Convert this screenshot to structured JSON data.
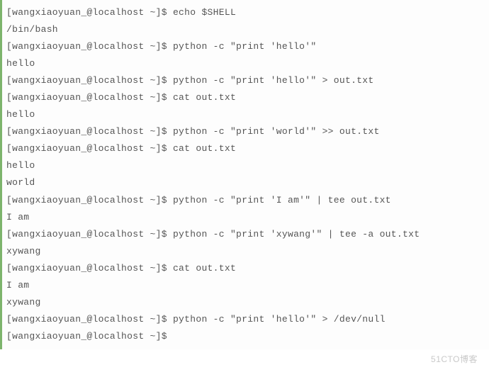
{
  "prompt": "[wangxiaoyuan_@localhost ~]$ ",
  "lines": [
    {
      "type": "cmd",
      "text": "echo $SHELL"
    },
    {
      "type": "out",
      "text": "/bin/bash"
    },
    {
      "type": "cmd",
      "text": "python -c \"print 'hello'\""
    },
    {
      "type": "out",
      "text": "hello"
    },
    {
      "type": "cmd",
      "text": "python -c \"print 'hello'\" > out.txt"
    },
    {
      "type": "cmd",
      "text": "cat out.txt"
    },
    {
      "type": "out",
      "text": "hello"
    },
    {
      "type": "cmd",
      "text": "python -c \"print 'world'\" >> out.txt"
    },
    {
      "type": "cmd",
      "text": "cat out.txt"
    },
    {
      "type": "out",
      "text": "hello"
    },
    {
      "type": "out",
      "text": "world"
    },
    {
      "type": "cmd",
      "text": "python -c \"print 'I am'\" | tee out.txt"
    },
    {
      "type": "out",
      "text": "I am"
    },
    {
      "type": "cmd",
      "text": "python -c \"print 'xywang'\" | tee -a out.txt"
    },
    {
      "type": "out",
      "text": "xywang"
    },
    {
      "type": "cmd",
      "text": "cat out.txt"
    },
    {
      "type": "out",
      "text": "I am"
    },
    {
      "type": "out",
      "text": "xywang"
    },
    {
      "type": "cmd",
      "text": "python -c \"print 'hello'\" > /dev/null"
    },
    {
      "type": "cmd",
      "text": ""
    }
  ],
  "watermark": "51CTO博客"
}
